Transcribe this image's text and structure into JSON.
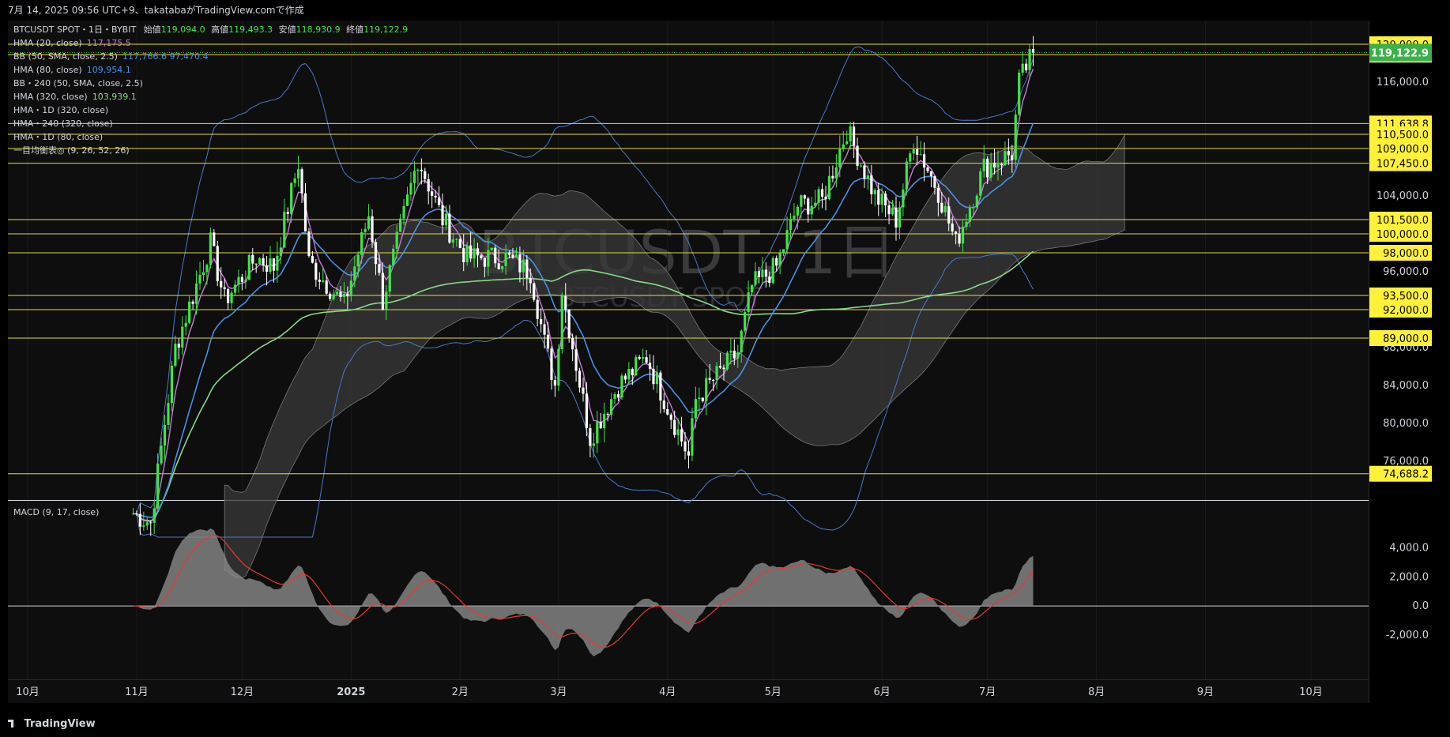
{
  "header": {
    "caption": "7月 14, 2025 09:56 UTC+9、takatabaがTradingView.comで作成"
  },
  "footer": {
    "brand": "TradingView"
  },
  "colors": {
    "bg": "#0e0e0e",
    "axis_bg": "#000000",
    "grid": "#1a1a1a",
    "up": "#3fe34a",
    "down": "#ffffff",
    "level": "#e7d94a",
    "hma20": "#c67ad6",
    "hma80": "#4a90e2",
    "hma320": "#8bd88b",
    "bb": "#4a78c8",
    "cloud": "#3a3a3a",
    "macd_hist": "#8a8a8a",
    "macd_signal": "#e53935",
    "label_yellow": "#fff13a",
    "label_green": "#3cb04a"
  },
  "legend": {
    "line1_symbol": "BTCUSDT SPOT・1日・BYBIT",
    "open_label": "始値",
    "open": "119,094.0",
    "high_label": "高値",
    "high": "119,493.3",
    "low_label": "安値",
    "low": "118,930.9",
    "close_label": "終値",
    "close": "119,122.9",
    "ind": [
      {
        "name": "HMA (20, close)",
        "value": "117,175.5",
        "color": "#c67ad6"
      },
      {
        "name": "BB (50, SMA, close, 2.5)",
        "value": "117,766.6  97,470.4",
        "color": "#4a90e2"
      },
      {
        "name": "HMA (80, close)",
        "value": "109,954.1",
        "color": "#4a90e2"
      },
      {
        "name": "BB・240 (50, SMA, close, 2.5)",
        "value": "",
        "color": ""
      },
      {
        "name": "HMA (320, close)",
        "value": "103,939.1",
        "color": "#8bd88b"
      },
      {
        "name": "HMA・1D (320, close)",
        "value": "",
        "color": ""
      },
      {
        "name": "HMA・240 (320, close)",
        "value": "",
        "color": ""
      },
      {
        "name": "HMA・1D (80, close)",
        "value": "",
        "color": ""
      },
      {
        "name": "一目均衡表◎ (9, 26, 52, 26)",
        "value": "",
        "color": ""
      }
    ]
  },
  "watermark": {
    "big": "BTCUSDT, 1日",
    "small": "BTCUSDT SPOT"
  },
  "macd_title": "MACD (9, 17, close)",
  "chart_data": {
    "type": "line",
    "title": "BTCUSDT SPOT・1日・BYBIT",
    "x_labels": [
      "10月",
      "11月",
      "12月",
      "2025",
      "2月",
      "3月",
      "4月",
      "5月",
      "6月",
      "7月",
      "8月",
      "9月",
      "10月"
    ],
    "price_axis": {
      "ylim": [
        72000,
        122500
      ],
      "ticks": [
        "116,000.0",
        "104,000.0",
        "96,000.0",
        "88,000.0",
        "84,000.0",
        "80,000.0",
        "76,000.0"
      ],
      "levels": [
        "120,000.0",
        "118,900.0",
        "111,638.8",
        "110,500.0",
        "109,000.0",
        "107,450.0",
        "101,500.0",
        "100,000.0",
        "98,000.0",
        "93,500.0",
        "92,000.0",
        "89,000.0",
        "74,688.2"
      ],
      "last_price": "119,122.9"
    },
    "macd_axis": {
      "ylim": [
        -3200,
        5500
      ],
      "ticks": [
        "4,000.0",
        "2,000.0",
        "0.0",
        "-2,000.0"
      ]
    },
    "price_series": [
      {
        "date": "2024-10-31",
        "close": 70500
      },
      {
        "date": "2024-11-05",
        "close": 69500
      },
      {
        "date": "2024-11-12",
        "close": 88000
      },
      {
        "date": "2024-11-22",
        "close": 99000
      },
      {
        "date": "2024-11-26",
        "close": 93000
      },
      {
        "date": "2024-12-05",
        "close": 97500
      },
      {
        "date": "2024-12-10",
        "close": 96500
      },
      {
        "date": "2024-12-17",
        "close": 107500
      },
      {
        "date": "2024-12-20",
        "close": 97000
      },
      {
        "date": "2024-12-30",
        "close": 92500
      },
      {
        "date": "2025-01-06",
        "close": 102000
      },
      {
        "date": "2025-01-10",
        "close": 93000
      },
      {
        "date": "2025-01-20",
        "close": 108000
      },
      {
        "date": "2025-01-27",
        "close": 101500
      },
      {
        "date": "2025-02-03",
        "close": 97500
      },
      {
        "date": "2025-02-14",
        "close": 97500
      },
      {
        "date": "2025-02-21",
        "close": 96000
      },
      {
        "date": "2025-02-25",
        "close": 88500
      },
      {
        "date": "2025-02-28",
        "close": 84000
      },
      {
        "date": "2025-03-02",
        "close": 94000
      },
      {
        "date": "2025-03-10",
        "close": 78500
      },
      {
        "date": "2025-03-18",
        "close": 84000
      },
      {
        "date": "2025-03-26",
        "close": 87000
      },
      {
        "date": "2025-04-07",
        "close": 76500
      },
      {
        "date": "2025-04-09",
        "close": 82500
      },
      {
        "date": "2025-04-21",
        "close": 87500
      },
      {
        "date": "2025-04-25",
        "close": 94500
      },
      {
        "date": "2025-05-02",
        "close": 96500
      },
      {
        "date": "2025-05-08",
        "close": 103000
      },
      {
        "date": "2025-05-15",
        "close": 103500
      },
      {
        "date": "2025-05-22",
        "close": 111000
      },
      {
        "date": "2025-05-30",
        "close": 104000
      },
      {
        "date": "2025-06-05",
        "close": 101500
      },
      {
        "date": "2025-06-10",
        "close": 110000
      },
      {
        "date": "2025-06-17",
        "close": 104500
      },
      {
        "date": "2025-06-22",
        "close": 99000
      },
      {
        "date": "2025-06-30",
        "close": 107000
      },
      {
        "date": "2025-07-08",
        "close": 108500
      },
      {
        "date": "2025-07-10",
        "close": 116000
      },
      {
        "date": "2025-07-14",
        "close": 119122.9
      }
    ]
  }
}
